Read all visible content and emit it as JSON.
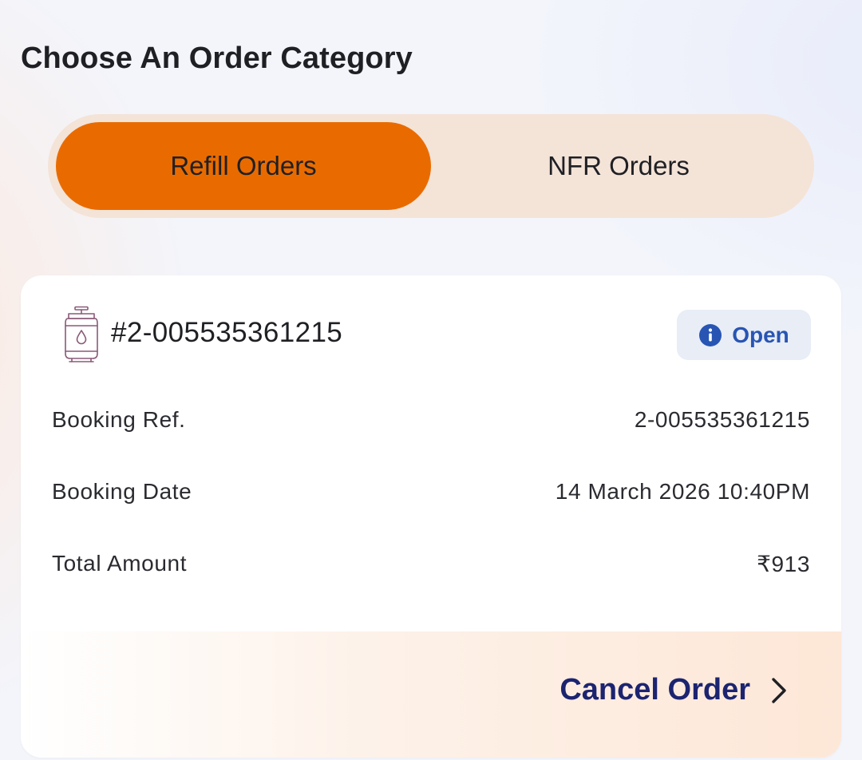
{
  "header": {
    "title": "Choose An Order Category"
  },
  "tabs": [
    {
      "label": "Refill Orders",
      "active": true
    },
    {
      "label": "NFR Orders",
      "active": false
    }
  ],
  "order": {
    "icon": "gas-cylinder-icon",
    "id": "#2-005535361215",
    "status": {
      "label": "Open",
      "icon": "info-icon"
    },
    "details": [
      {
        "label": "Booking Ref.",
        "value": "2-005535361215"
      },
      {
        "label": "Booking Date",
        "value": "14 March 2026 10:40PM"
      },
      {
        "label": "Total Amount",
        "value": "₹913"
      }
    ],
    "action": {
      "label": "Cancel Order",
      "icon": "chevron-right-icon"
    }
  },
  "colors": {
    "accent": "#e96b00",
    "tab_track": "#f4e3d7",
    "status_text": "#2855b3",
    "status_bg": "#e8edf6",
    "action_text": "#1c2470",
    "cylinder_stroke": "#8a5a78"
  }
}
